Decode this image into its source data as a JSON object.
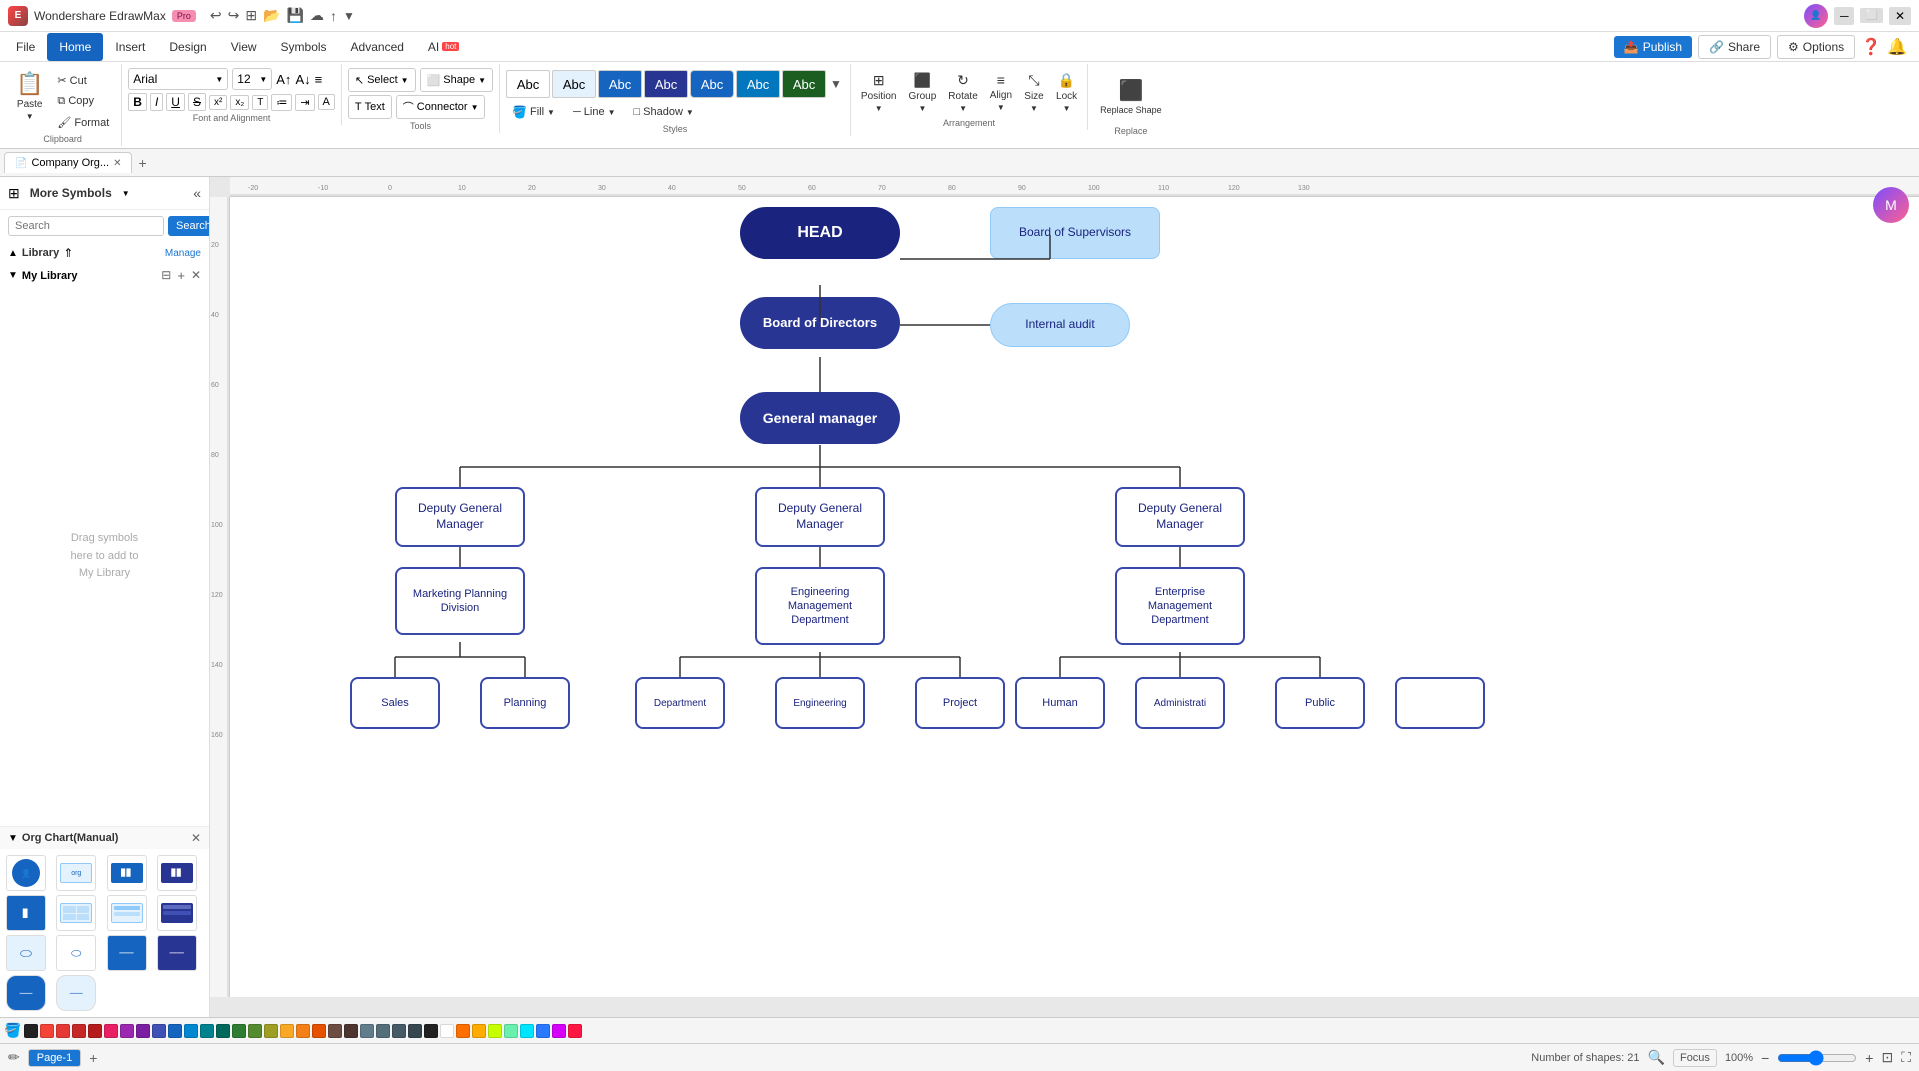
{
  "app": {
    "name": "Wondershare EdrawMax",
    "badge": "Pro",
    "title": "Company Org..."
  },
  "menu": {
    "items": [
      "File",
      "Home",
      "Insert",
      "Design",
      "View",
      "Symbols",
      "Advanced",
      "AI"
    ]
  },
  "ribbon": {
    "clipboard": {
      "label": "Clipboard",
      "cut": "✂",
      "copy": "⧉",
      "paste_label": "Paste",
      "format_painter": "🖌"
    },
    "font": {
      "label": "Font and Alignment",
      "family": "Arial",
      "size": "12",
      "bold": "B",
      "italic": "I",
      "underline": "U",
      "strikethrough": "S",
      "superscript": "x²",
      "subscript": "x₂"
    },
    "tools": {
      "label": "Tools",
      "select": "Select",
      "text": "Text",
      "shape": "Shape",
      "connector": "Connector"
    },
    "styles": {
      "label": "Styles",
      "items": [
        "Abc",
        "Abc",
        "Abc",
        "Abc",
        "Abc",
        "Abc",
        "Abc"
      ]
    },
    "format": {
      "fill": "Fill",
      "line": "Line",
      "shadow": "Shadow"
    },
    "arrangement": {
      "label": "Arrangement",
      "position": "Position",
      "group": "Group",
      "rotate": "Rotate",
      "align": "Align",
      "size": "Size",
      "lock": "Lock"
    },
    "replace": {
      "label": "Replace",
      "replace_shape": "Replace Shape",
      "replace": "Replace"
    }
  },
  "header_actions": {
    "publish": "Publish",
    "share": "Share",
    "options": "Options"
  },
  "tabs": {
    "active": "Company Org..."
  },
  "left_panel": {
    "title": "More Symbols",
    "search_placeholder": "Search",
    "search_btn": "Search",
    "library_label": "Library",
    "manage_label": "Manage",
    "my_library_label": "My Library",
    "drag_text": "Drag symbols\nhere to add to\nMy Library",
    "org_chart_section": "Org Chart(Manual)"
  },
  "org_chart": {
    "head": "HEAD",
    "board_supervisors": "Board of Supervisors",
    "board_directors": "Board of Directors",
    "internal_audit": "Internal audit",
    "general_manager": "General manager",
    "deputy_gm_1": "Deputy General\nManager",
    "deputy_gm_2": "Deputy General\nManager",
    "deputy_gm_3": "Deputy General\nManager",
    "marketing": "Marketing Planning\nDivision",
    "engineering_dept": "Engineering\nManagement\nDepartment",
    "enterprise_dept": "Enterprise\nManagement\nDepartment",
    "sales": "Sales",
    "planning": "Planning",
    "department": "Department",
    "engineering": "Engineering",
    "project": "Project",
    "human": "Human",
    "administration": "Administrati",
    "public": "Public"
  },
  "bottom": {
    "page_label": "Page-1",
    "page_tab": "Page-1",
    "add_page": "+",
    "shapes_count": "Number of shapes: 21",
    "focus": "Focus",
    "zoom": "100%"
  },
  "colors": [
    "#e53935",
    "#e53935",
    "#d32f2f",
    "#c62828",
    "#e91e63",
    "#9c27b0",
    "#7b1fa2",
    "#3f51b5",
    "#1565c0",
    "#0288d1",
    "#00838f",
    "#2e7d32",
    "#558b2f",
    "#f57f17",
    "#e65100",
    "#4e342e",
    "#37474f",
    "#212121",
    "#ffffff"
  ],
  "status_colors": {
    "head_bg": "#1a237e",
    "board_bg": "#283593",
    "light_blue": "#bbdefb",
    "node_border": "#3949ab",
    "white": "#ffffff"
  }
}
